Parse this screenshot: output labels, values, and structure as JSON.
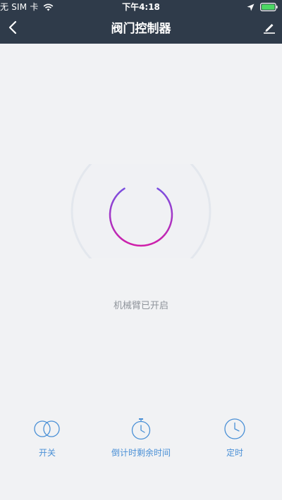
{
  "status_bar": {
    "carrier": "无 SIM 卡",
    "time": "下午4:18"
  },
  "navbar": {
    "title": "阀门控制器"
  },
  "power": {
    "status_text": "机械臂已开启",
    "gradient_start": "#7a4fe0",
    "gradient_end": "#d01ea9"
  },
  "actions": {
    "switch_label": "开关",
    "countdown_label": "倒计时剩余时间",
    "timer_label": "定时"
  },
  "colors": {
    "header_bg": "#2f3b4a",
    "page_bg": "#f1f2f4",
    "accent_blue": "#4a90d6",
    "status_text": "#8f949b"
  }
}
